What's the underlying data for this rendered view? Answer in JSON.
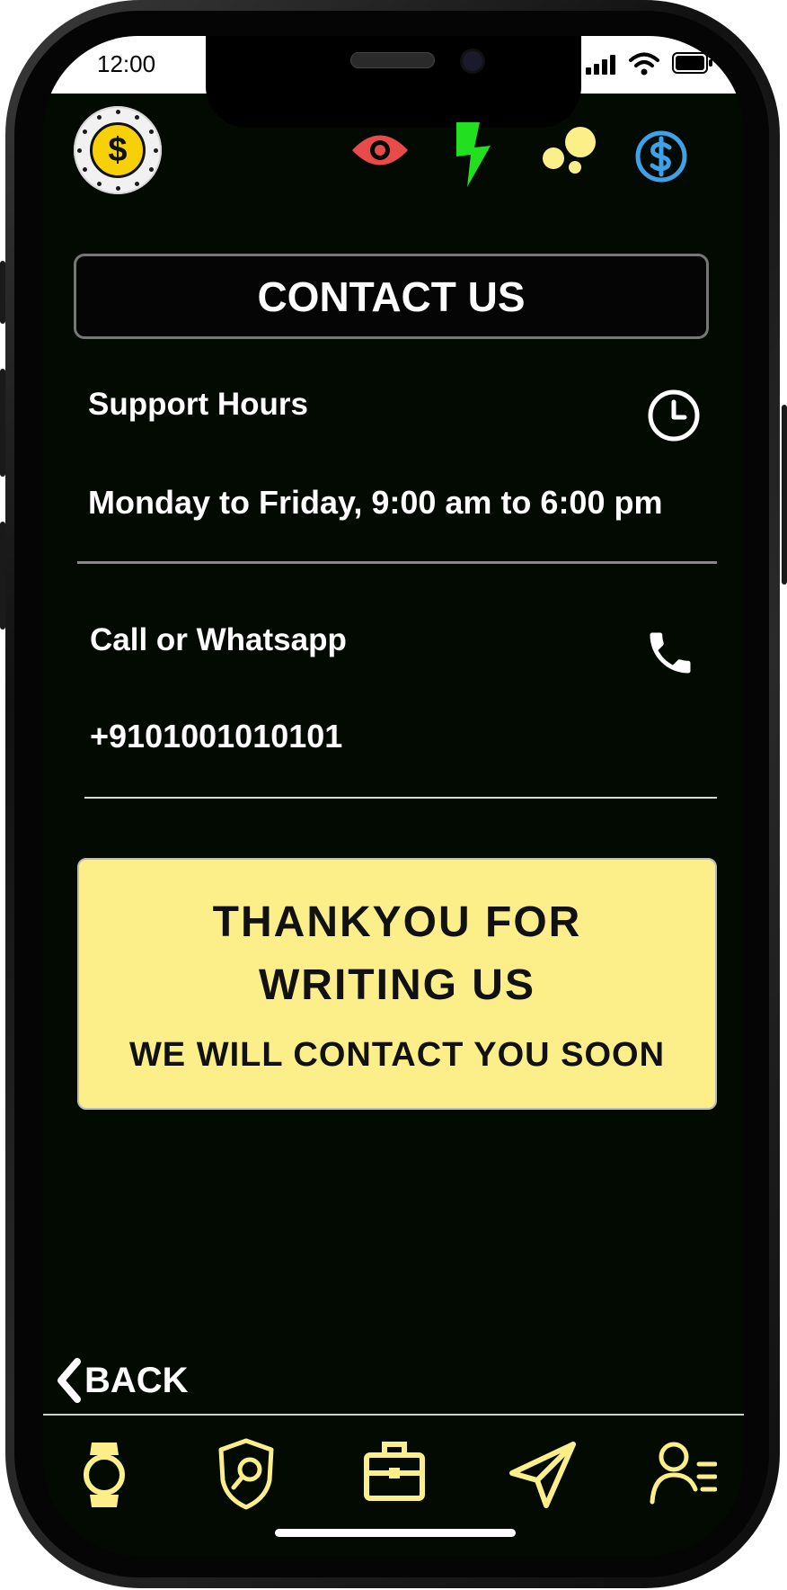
{
  "status_bar": {
    "time": "12:00"
  },
  "header": {
    "coin_symbol": "$",
    "icons": [
      "eye-icon",
      "lightning-icon",
      "bubbles-icon",
      "dollar-circle-icon"
    ]
  },
  "page": {
    "title": "CONTACT US",
    "support_label": "Support Hours",
    "support_value": "Monday to Friday, 9:00 am to 6:00 pm",
    "call_label": "Call or Whatsapp",
    "call_value": "+9101001010101"
  },
  "thank_card": {
    "line1": "THANKYOU FOR",
    "line2": "WRITING US",
    "line3": "WE WILL CONTACT YOU SOON"
  },
  "back_label": "BACK",
  "bottom_nav": [
    "watch-icon",
    "shield-search-icon",
    "briefcase-icon",
    "send-icon",
    "user-list-icon"
  ],
  "colors": {
    "background": "#020a02",
    "accent_yellow": "#fcef8a",
    "eye_red": "#e94b4b",
    "bolt_green": "#22e01f",
    "dollar_blue": "#3fa2e8",
    "nav_icon": "#fcef8a"
  }
}
